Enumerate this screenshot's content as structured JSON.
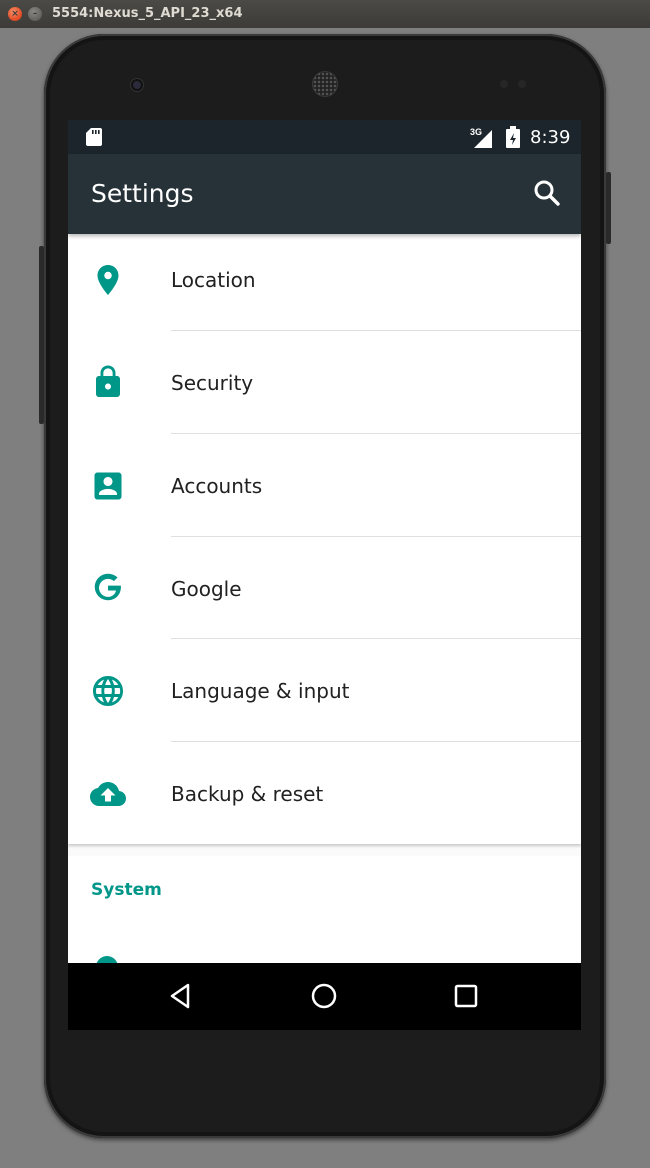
{
  "window": {
    "title": "5554:Nexus_5_API_23_x64",
    "close_glyph": "×",
    "minimize_glyph": "–"
  },
  "status_bar": {
    "network": "3G",
    "time": "8:39",
    "notification_icon": "sd-card-icon"
  },
  "app_bar": {
    "title": "Settings",
    "action_icon": "search-icon"
  },
  "settings_items": [
    {
      "label": "Location",
      "icon": "location-pin-icon"
    },
    {
      "label": "Security",
      "icon": "lock-icon"
    },
    {
      "label": "Accounts",
      "icon": "account-box-icon"
    },
    {
      "label": "Google",
      "icon": "google-icon"
    },
    {
      "label": "Language & input",
      "icon": "globe-icon"
    },
    {
      "label": "Backup & reset",
      "icon": "cloud-upload-icon"
    }
  ],
  "system_section": {
    "header": "System"
  },
  "nav_bar": {
    "buttons": [
      "back-icon",
      "home-icon",
      "recents-icon"
    ]
  },
  "colors": {
    "accent": "#009688",
    "app_bar": "#263238",
    "status_bar": "#1c252b"
  }
}
